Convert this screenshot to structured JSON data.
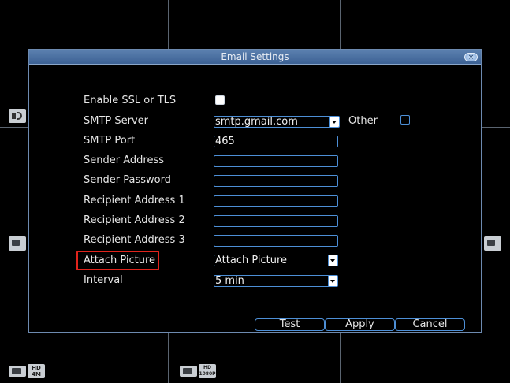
{
  "dialog": {
    "title": "Email Settings",
    "close_label": "×"
  },
  "form": {
    "ssl_label": "Enable SSL or TLS",
    "smtp_server_label": "SMTP Server",
    "smtp_server_value": "smtp.gmail.com",
    "other_label": "Other",
    "smtp_port_label": "SMTP Port",
    "smtp_port_value": "465",
    "sender_address_label": "Sender Address",
    "sender_password_label": "Sender Password",
    "recipient1_label": "Recipient Address 1",
    "recipient2_label": "Recipient Address 2",
    "recipient3_label": "Recipient Address 3",
    "attach_picture_label": "Attach Picture",
    "attach_picture_value": "Attach Picture",
    "interval_label": "Interval",
    "interval_value": "5 min"
  },
  "buttons": {
    "test": "Test",
    "apply": "Apply",
    "cancel": "Cancel"
  },
  "badges": {
    "hd4m_top": "HD",
    "hd4m_bottom": "4M",
    "hd1080_top": "HD",
    "hd1080_bottom": "1080P"
  },
  "colors": {
    "accent": "#4d8fd6",
    "titlebar": "#4a6fa3",
    "highlight": "#e0241c"
  }
}
